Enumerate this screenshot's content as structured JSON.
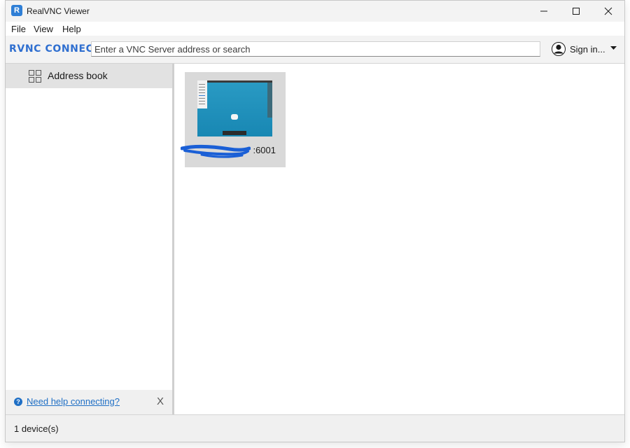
{
  "window": {
    "title": "RealVNC Viewer",
    "app_icon": "R",
    "controls": [
      "minimize-icon",
      "maximize-icon",
      "close-icon"
    ]
  },
  "menu": {
    "items": [
      {
        "label": "File"
      },
      {
        "label": "View"
      },
      {
        "label": "Help"
      }
    ]
  },
  "toolbar": {
    "brand": "RVNC CONNECT",
    "search_placeholder": "Enter a VNC Server address or search",
    "search_value": "",
    "sign_in_label": "Sign in..."
  },
  "sidebar": {
    "address_book_label": "Address book",
    "help_link": "Need help connecting?",
    "help_close": "X"
  },
  "main": {
    "devices": [
      {
        "label_visible": ":6001"
      }
    ]
  },
  "status": {
    "text": "1 device(s)"
  },
  "colors": {
    "accent": "#2f6fd0",
    "link": "#1f6fc5",
    "selection": "#e2e2e2",
    "card": "#d9d9d9",
    "scribble": "#1a5fd6"
  }
}
